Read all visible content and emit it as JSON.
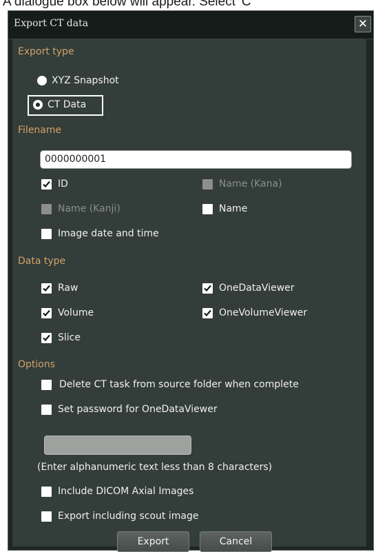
{
  "caption": "A dialogue box below will appear. Select 'C",
  "dialog": {
    "title": "Export CT data",
    "close_icon": "close-icon"
  },
  "export_type": {
    "label": "Export type",
    "options": [
      {
        "label": "XYZ Snapshot",
        "selected": false
      },
      {
        "label": "CT Data",
        "selected": true
      }
    ]
  },
  "filename": {
    "label": "Filename",
    "value": "0000000001",
    "options": [
      {
        "label": "ID",
        "checked": true,
        "enabled": true
      },
      {
        "label": "Name (Kana)",
        "checked": false,
        "enabled": false
      },
      {
        "label": "Name (Kanji)",
        "checked": false,
        "enabled": false
      },
      {
        "label": "Name",
        "checked": false,
        "enabled": true
      },
      {
        "label": "Image date and time",
        "checked": false,
        "enabled": true
      }
    ]
  },
  "data_type": {
    "label": "Data type",
    "options": [
      {
        "label": "Raw",
        "checked": true
      },
      {
        "label": "OneDataViewer",
        "checked": true
      },
      {
        "label": "Volume",
        "checked": true
      },
      {
        "label": "OneVolumeViewer",
        "checked": true
      },
      {
        "label": "Slice",
        "checked": true
      }
    ]
  },
  "options": {
    "label": "Options",
    "delete_task": {
      "label": "Delete CT task from source folder when complete",
      "checked": false
    },
    "set_password": {
      "label": "Set password for OneDataViewer",
      "checked": false
    },
    "password_value": "",
    "password_hint": "(Enter alphanumeric text less than 8 characters)",
    "include_dicom": {
      "label": "Include DICOM Axial Images",
      "checked": false
    },
    "include_scout": {
      "label": "Export including scout image",
      "checked": false
    }
  },
  "buttons": {
    "export": "Export",
    "cancel": "Cancel"
  },
  "colors": {
    "section_label": "#d1a26a",
    "panel": "#333d39",
    "titlebar": "#151c19"
  }
}
